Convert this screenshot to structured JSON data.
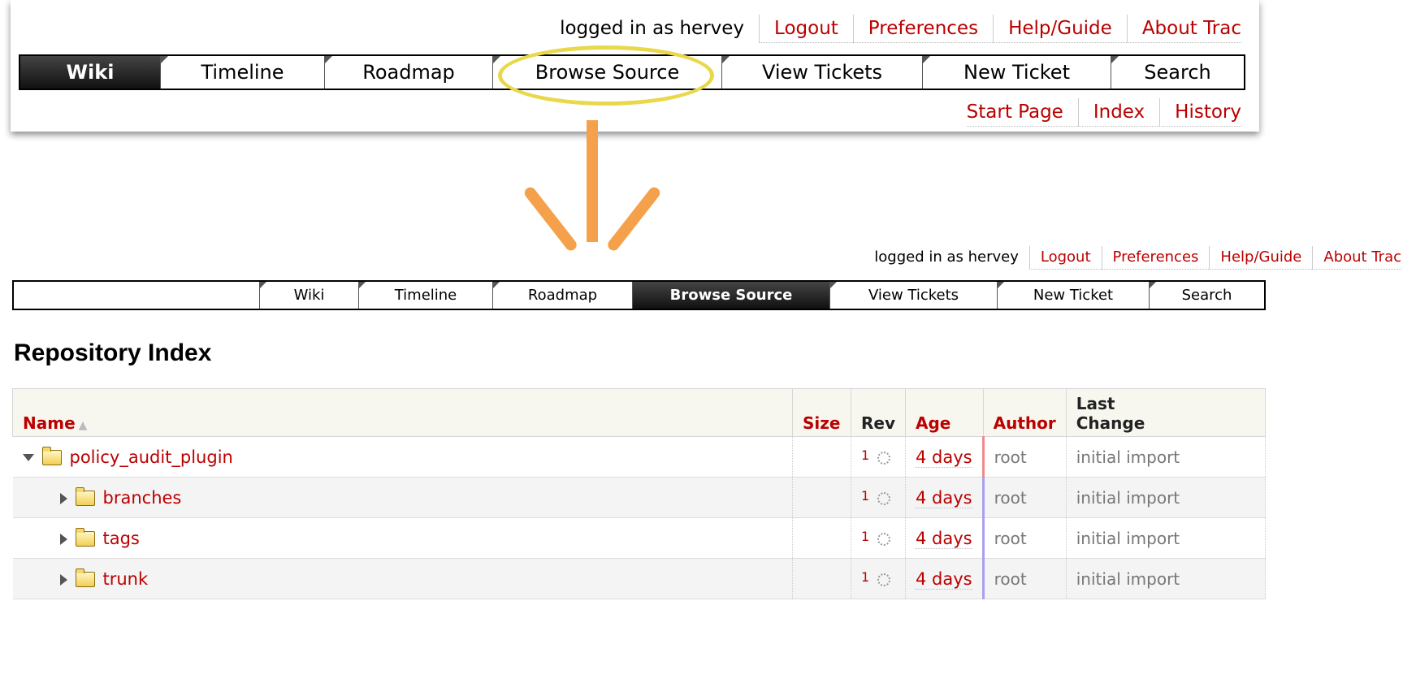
{
  "top_panel": {
    "meta": [
      "logged in as hervey",
      "Logout",
      "Preferences",
      "Help/Guide",
      "About Trac"
    ],
    "nav_tabs": [
      {
        "label": "Wiki",
        "active": true
      },
      {
        "label": "Timeline"
      },
      {
        "label": "Roadmap"
      },
      {
        "label": "Browse Source"
      },
      {
        "label": "View Tickets"
      },
      {
        "label": "New Ticket"
      },
      {
        "label": "Search"
      }
    ],
    "context_nav": [
      "Start Page",
      "Index",
      "History"
    ]
  },
  "bottom_panel": {
    "meta": [
      "logged in as hervey",
      "Logout",
      "Preferences",
      "Help/Guide",
      "About Trac"
    ],
    "nav_tabs": [
      {
        "label": "Wiki"
      },
      {
        "label": "Timeline"
      },
      {
        "label": "Roadmap"
      },
      {
        "label": "Browse Source",
        "active": true
      },
      {
        "label": "View Tickets"
      },
      {
        "label": "New Ticket"
      },
      {
        "label": "Search"
      }
    ],
    "title": "Repository Index",
    "table": {
      "headers": {
        "name": "Name",
        "size": "Size",
        "rev": "Rev",
        "age": "Age",
        "author": "Author",
        "change_line1": "Last",
        "change_line2": "Change"
      },
      "sort_indicator": "▲",
      "rows": [
        {
          "name": "policy_audit_plugin",
          "size": "",
          "rev": "1",
          "age": "4 days",
          "author": "root",
          "change": "initial import"
        },
        {
          "name": "branches",
          "size": "",
          "rev": "1",
          "age": "4 days",
          "author": "root",
          "change": "initial import"
        },
        {
          "name": "tags",
          "size": "",
          "rev": "1",
          "age": "4 days",
          "author": "root",
          "change": "initial import"
        },
        {
          "name": "trunk",
          "size": "",
          "rev": "1",
          "age": "4 days",
          "author": "root",
          "change": "initial import"
        }
      ]
    }
  },
  "colors": {
    "link": "#b00000",
    "highlight_ring": "#e8d84a",
    "arrow": "#f5a04a"
  }
}
